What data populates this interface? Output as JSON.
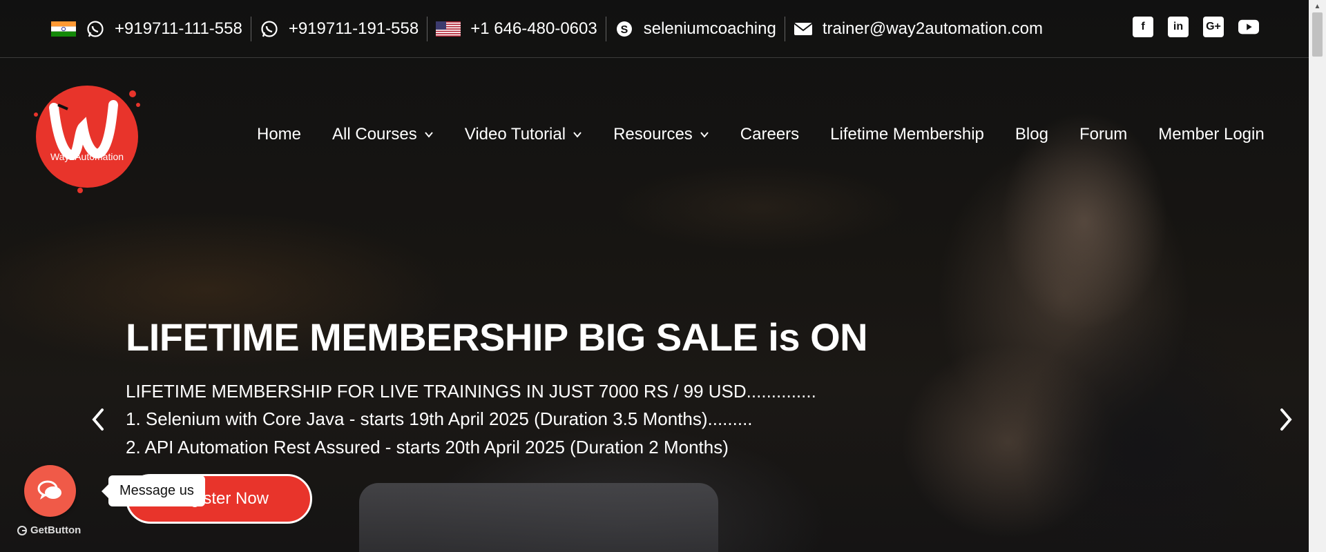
{
  "topbar": {
    "contacts": [
      {
        "type": "whatsapp",
        "flag": "india-flag",
        "text": "+919711-111-558"
      },
      {
        "type": "whatsapp",
        "text": "+919711-191-558"
      },
      {
        "type": "phone",
        "flag": "usa-flag",
        "text": "+1 646-480-0603"
      },
      {
        "type": "skype",
        "text": "seleniumcoaching"
      },
      {
        "type": "email",
        "text": "trainer@way2automation.com"
      }
    ],
    "socials": [
      "facebook-icon",
      "linkedin-icon",
      "google-plus-icon",
      "youtube-icon"
    ]
  },
  "logo": {
    "brand_text": "Way2Automation"
  },
  "nav": {
    "items": [
      {
        "label": "Home",
        "dropdown": false
      },
      {
        "label": "All Courses",
        "dropdown": true
      },
      {
        "label": "Video Tutorial",
        "dropdown": true
      },
      {
        "label": "Resources",
        "dropdown": true
      },
      {
        "label": "Careers",
        "dropdown": false
      },
      {
        "label": "Lifetime Membership",
        "dropdown": false
      },
      {
        "label": "Blog",
        "dropdown": false
      },
      {
        "label": "Forum",
        "dropdown": false
      },
      {
        "label": "Member Login",
        "dropdown": false
      }
    ]
  },
  "hero": {
    "title": "LIFETIME MEMBERSHIP BIG SALE is ON",
    "line1": "LIFETIME MEMBERSHIP FOR LIVE TRAININGS IN JUST 7000 RS / 99 USD..............",
    "line2": "1. Selenium with Core Java - starts 19th April 2025 (Duration 3.5 Months).........",
    "line3": "2. API Automation Rest Assured - starts 20th April 2025 (Duration 2 Months)",
    "register_label": "Register Now"
  },
  "chat": {
    "tooltip": "Message us",
    "branding": "GetButton"
  },
  "colors": {
    "accent": "#e8342b",
    "chat": "#f05a48",
    "topbar_text": "#ffffff"
  }
}
